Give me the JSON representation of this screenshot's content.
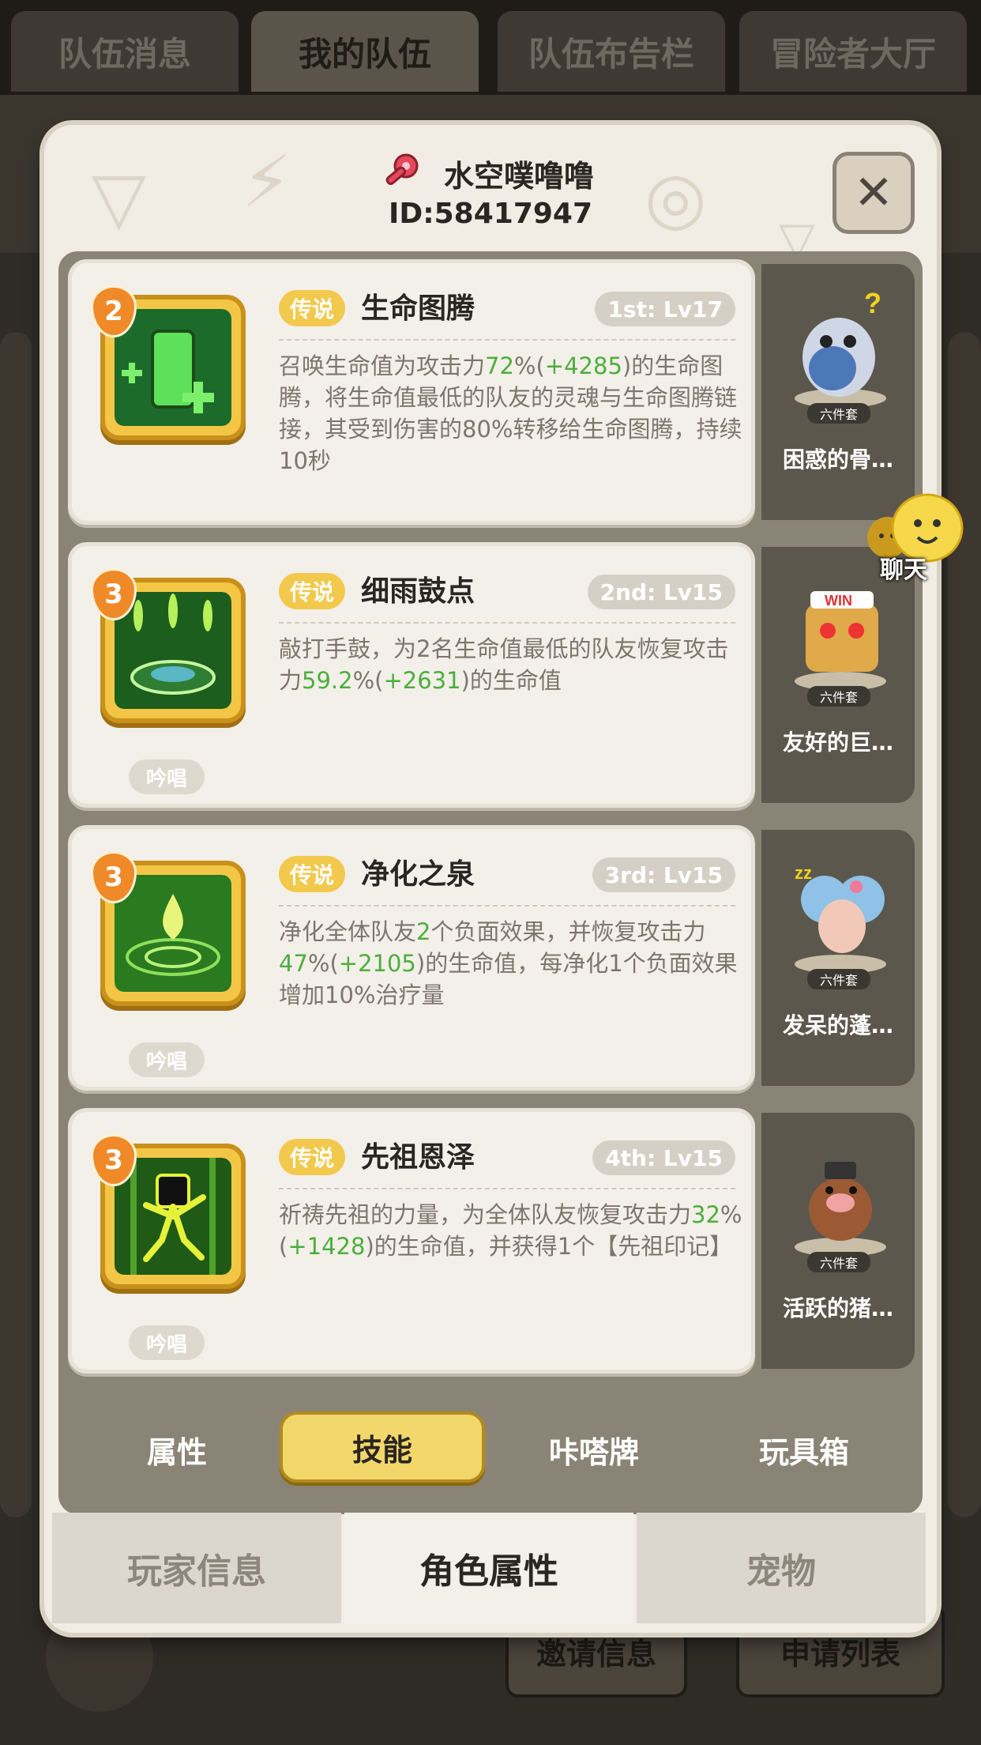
{
  "top_tabs": [
    {
      "label": "队伍消息"
    },
    {
      "label": "我的队伍"
    },
    {
      "label": "队伍布告栏"
    },
    {
      "label": "冒险者大厅"
    }
  ],
  "background_buttons": {
    "invite": "邀请信息",
    "applications": "申请列表"
  },
  "player": {
    "name": "水空噗噜噜",
    "id": "ID:58417947"
  },
  "skills": [
    {
      "level": "2",
      "rarity": "传说",
      "name": "生命图腾",
      "slot": "1st: Lv17",
      "desc": [
        {
          "t": "召唤生命值为攻击力"
        },
        {
          "t": "72",
          "g": true
        },
        {
          "t": "%("
        },
        {
          "t": "+4285",
          "g": true
        },
        {
          "t": ")的生命图腾，将生命值最低的队友的灵魂与生命图腾链接，其受到伤害的80%转移给生命图腾，持续10秒"
        }
      ],
      "chant": "",
      "pet": {
        "name": "困惑的骨…",
        "set": "六件套"
      }
    },
    {
      "level": "3",
      "rarity": "传说",
      "name": "细雨鼓点",
      "slot": "2nd: Lv15",
      "desc": [
        {
          "t": "敲打手鼓，为2名生命值最低的队友恢复攻击力"
        },
        {
          "t": "59.2",
          "g": true
        },
        {
          "t": "%("
        },
        {
          "t": "+2631",
          "g": true
        },
        {
          "t": ")的生命值"
        }
      ],
      "chant": "吟唱",
      "pet": {
        "name": "友好的巨…",
        "set": "六件套"
      }
    },
    {
      "level": "3",
      "rarity": "传说",
      "name": "净化之泉",
      "slot": "3rd: Lv15",
      "desc": [
        {
          "t": "净化全体队友"
        },
        {
          "t": "2",
          "g": true
        },
        {
          "t": "个负面效果，并恢复攻击力"
        },
        {
          "t": "47",
          "g": true
        },
        {
          "t": "%("
        },
        {
          "t": "+2105",
          "g": true
        },
        {
          "t": ")的生命值，每净化1个负面效果增加10%治疗量"
        }
      ],
      "chant": "吟唱",
      "pet": {
        "name": "发呆的蓬…",
        "set": "六件套"
      }
    },
    {
      "level": "3",
      "rarity": "传说",
      "name": "先祖恩泽",
      "slot": "4th: Lv15",
      "desc": [
        {
          "t": "祈祷先祖的力量，为全体队友恢复攻击力"
        },
        {
          "t": "32",
          "g": true
        },
        {
          "t": "%("
        },
        {
          "t": "+1428",
          "g": true
        },
        {
          "t": ")的生命值，并获得1个【先祖印记】"
        }
      ],
      "chant": "吟唱",
      "pet": {
        "name": "活跃的猪…",
        "set": "六件套"
      }
    }
  ],
  "chat": {
    "label": "聊天"
  },
  "sub_tabs": [
    {
      "label": "属性"
    },
    {
      "label": "技能",
      "active": true
    },
    {
      "label": "咔嗒牌"
    },
    {
      "label": "玩具箱"
    }
  ],
  "bottom_tabs": [
    {
      "label": "玩家信息"
    },
    {
      "label": "角色属性",
      "active": true
    },
    {
      "label": "宠物"
    }
  ],
  "colors": {
    "accent_green": "#4cae3d",
    "legend_badge": "#f2c94c",
    "panel": "#f1ede5",
    "gold_frame": "#f3c646"
  }
}
